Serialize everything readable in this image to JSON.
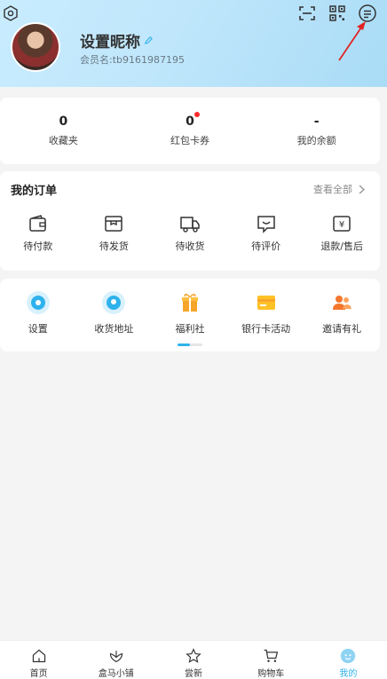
{
  "profile": {
    "nickname": "设置昵称",
    "member_id": "会员名:tb9161987195"
  },
  "top_icons": [
    "hexagon-settings-icon",
    "scan-icon",
    "qr-code-icon",
    "message-icon"
  ],
  "stats": [
    {
      "value": "0",
      "label": "收藏夹",
      "dot": false
    },
    {
      "value": "0",
      "label": "红包卡券",
      "dot": true
    },
    {
      "value": "-",
      "label": "我的余额",
      "dot": false
    }
  ],
  "orders": {
    "title": "我的订单",
    "more": "查看全部",
    "items": [
      {
        "label": "待付款",
        "icon": "wallet-icon"
      },
      {
        "label": "待发货",
        "icon": "package-icon"
      },
      {
        "label": "待收货",
        "icon": "truck-icon"
      },
      {
        "label": "待评价",
        "icon": "comment-icon"
      },
      {
        "label": "退款/售后",
        "icon": "refund-icon"
      }
    ]
  },
  "services": {
    "items": [
      {
        "label": "设置",
        "icon": "gear-icon"
      },
      {
        "label": "收货地址",
        "icon": "location-icon"
      },
      {
        "label": "福利社",
        "icon": "gift-icon"
      },
      {
        "label": "银行卡活动",
        "icon": "bank-card-icon"
      },
      {
        "label": "邀请有礼",
        "icon": "invite-icon"
      }
    ],
    "page": 1,
    "pages": 2
  },
  "tabs": [
    {
      "label": "首页",
      "icon": "home-icon"
    },
    {
      "label": "盒马小铺",
      "icon": "shop-icon"
    },
    {
      "label": "尝新",
      "icon": "star-icon"
    },
    {
      "label": "购物车",
      "icon": "cart-icon"
    },
    {
      "label": "我的",
      "icon": "profile-icon",
      "active": true
    }
  ],
  "colors": {
    "accent": "#2fb2ec",
    "badge": "#ff2a2a",
    "header": "#bfe6fb",
    "annotation_arrow": "#e02424"
  }
}
